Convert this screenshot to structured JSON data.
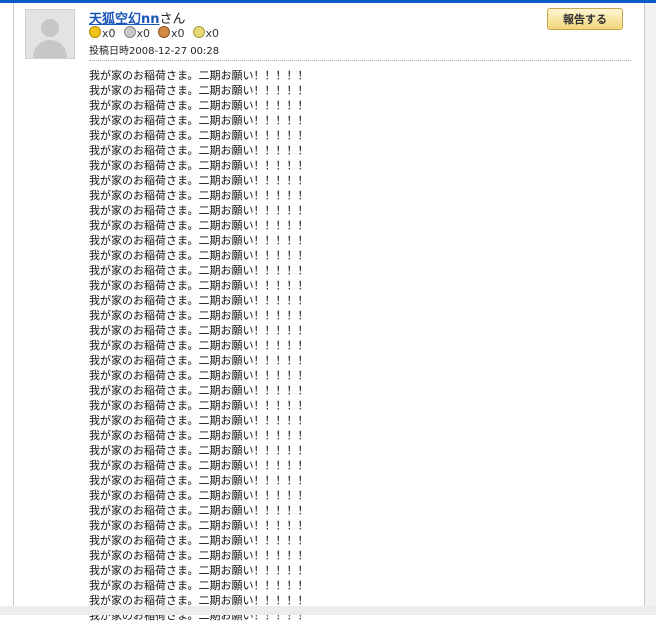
{
  "post": {
    "author": "天狐空幻nn",
    "author_suffix": "さん",
    "medals": [
      {
        "icon": "gold-medal-icon",
        "count": "x0"
      },
      {
        "icon": "silver-medal-icon",
        "count": "x0"
      },
      {
        "icon": "bronze-medal-icon",
        "count": "x0"
      },
      {
        "icon": "special-medal-icon",
        "count": "x0"
      }
    ],
    "posted_label": "投稿日時2008-12-27 00:28",
    "report_label": "報告する",
    "lines": [
      "我が家のお稲荷さま。二期お願い！！！！！",
      "我が家のお稲荷さま。二期お願い！！！！！",
      "我が家のお稲荷さま。二期お願い！！！！！",
      "我が家のお稲荷さま。二期お願い！！！！！",
      "我が家のお稲荷さま。二期お願い！！！！！",
      "我が家のお稲荷さま。二期お願い！！！！！",
      "我が家のお稲荷さま。二期お願い！！！！！",
      "我が家のお稲荷さま。二期お願い！！！！！",
      "我が家のお稲荷さま。二期お願い！！！！！",
      "我が家のお稲荷さま。二期お願い！！！！！",
      "我が家のお稲荷さま。二期お願い！！！！！",
      "我が家のお稲荷さま。二期お願い！！！！！",
      "我が家のお稲荷さま。二期お願い！！！！！",
      "我が家のお稲荷さま。二期お願い！！！！！",
      "我が家のお稲荷さま。二期お願い！！！！！",
      "我が家のお稲荷さま。二期お願い！！！！！",
      "我が家のお稲荷さま。二期お願い！！！！！",
      "我が家のお稲荷さま。二期お願い！！！！！",
      "我が家のお稲荷さま。二期お願い！！！！！",
      "我が家のお稲荷さま。二期お願い！！！！！",
      "我が家のお稲荷さま。二期お願い！！！！！",
      "我が家のお稲荷さま。二期お願い！！！！！",
      "我が家のお稲荷さま。二期お願い！！！！！",
      "我が家のお稲荷さま。二期お願い！！！！！",
      "我が家のお稲荷さま。二期お願い！！！！！",
      "我が家のお稲荷さま。二期お願い！！！！！",
      "我が家のお稲荷さま。二期お願い！！！！！",
      "我が家のお稲荷さま。二期お願い！！！！！",
      "我が家のお稲荷さま。二期お願い！！！！！",
      "我が家のお稲荷さま。二期お願い！！！！！",
      "我が家のお稲荷さま。二期お願い！！！！！",
      "我が家のお稲荷さま。二期お願い！！！！！",
      "我が家のお稲荷さま。二期お願い！！！！！",
      "我が家のお稲荷さま。二期お願い！！！！！",
      "我が家のお稲荷さま。二期お願い！！！！！",
      "我が家のお稲荷さま。二期お願い！！！！！",
      "我が家のお稲荷さま。二期お願い！！！！！"
    ]
  }
}
